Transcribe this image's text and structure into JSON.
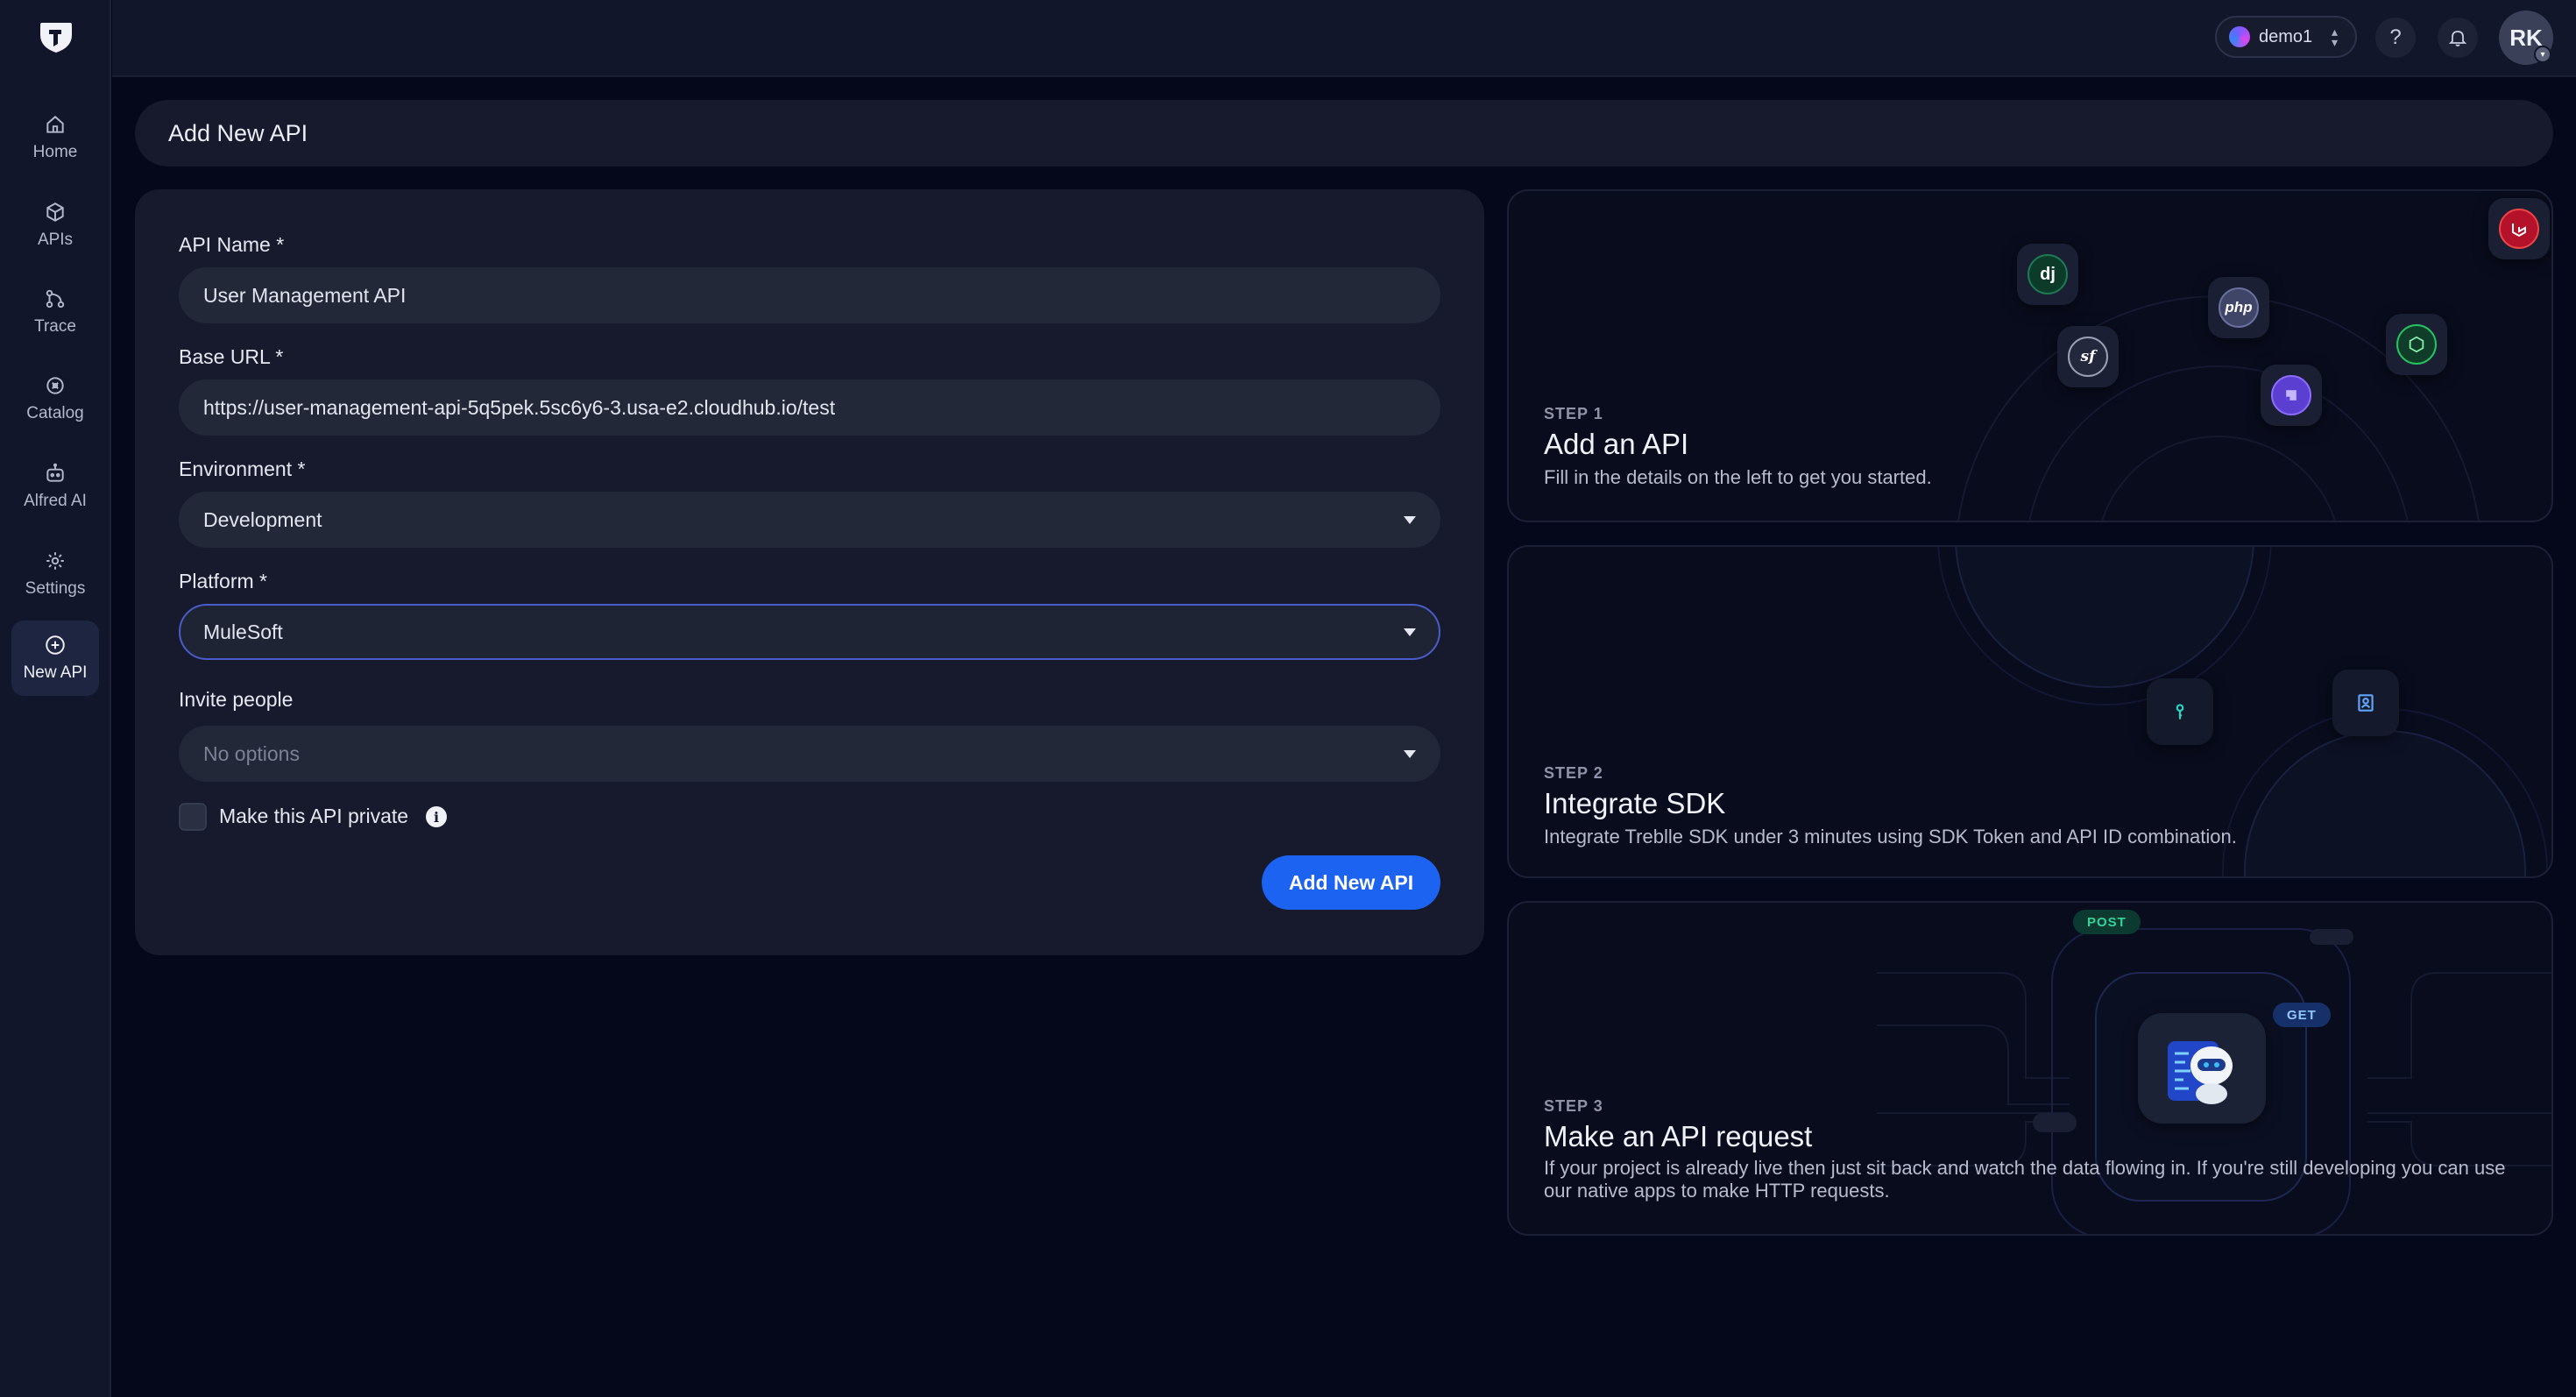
{
  "sidebar": {
    "items": [
      {
        "label": "Home",
        "icon": "home-icon"
      },
      {
        "label": "APIs",
        "icon": "cube-icon"
      },
      {
        "label": "Trace",
        "icon": "trace-icon"
      },
      {
        "label": "Catalog",
        "icon": "catalog-icon"
      },
      {
        "label": "Alfred AI",
        "icon": "robot-icon"
      },
      {
        "label": "Settings",
        "icon": "gear-icon"
      },
      {
        "label": "New API",
        "icon": "plus-circle-icon",
        "active": true
      }
    ]
  },
  "topbar": {
    "workspace": "demo1",
    "help_label": "?",
    "avatar_initials": "RK"
  },
  "page": {
    "title": "Add New API"
  },
  "form": {
    "api_name": {
      "label": "API Name *",
      "value": "User Management API"
    },
    "base_url": {
      "label": "Base URL *",
      "value": "https://user-management-api-5q5pek.5sc6y6-3.usa-e2.cloudhub.io/test"
    },
    "environment": {
      "label": "Environment *",
      "value": "Development"
    },
    "platform": {
      "label": "Platform *",
      "value": "MuleSoft"
    },
    "invite": {
      "label": "Invite people",
      "placeholder": "No options"
    },
    "private_label": "Make this API private",
    "info_glyph": "i",
    "submit_label": "Add New API"
  },
  "steps": [
    {
      "num": "STEP 1",
      "title": "Add an API",
      "desc": "Fill in the details on the left to get you started."
    },
    {
      "num": "STEP 2",
      "title": "Integrate SDK",
      "desc": "Integrate Treblle SDK under 3 minutes using SDK Token and API ID combination."
    },
    {
      "num": "STEP 3",
      "title": "Make an API request",
      "desc": "If your project is already live then just sit back and watch the data flowing in. If you're still developing you can use our native apps to make HTTP requests."
    }
  ],
  "step1_icons": {
    "django": "dj",
    "php": "php",
    "symfony": "sf"
  },
  "step3_pills": {
    "post": "POST",
    "get": "GET"
  },
  "colors": {
    "accent": "#1c63f2",
    "focus_border": "#4a5cc9",
    "background": "#05071a",
    "card": "#161a2c"
  }
}
